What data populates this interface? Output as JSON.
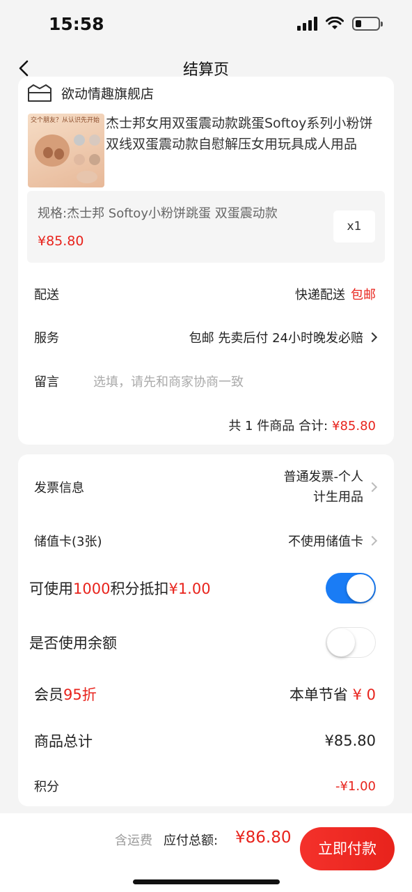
{
  "status_bar": {
    "time": "15:58",
    "battery_level": 0.28
  },
  "nav": {
    "title": "结算页",
    "back_icon": "chevron-left-icon"
  },
  "shop": {
    "name": "欲动情趣旗舰店",
    "icon": "store-icon"
  },
  "product": {
    "image_caption": "交个朋友？从认识先开始",
    "title": "杰士邦女用双蛋震动款跳蛋Softoy系列小粉饼双线双蛋震动款自慰解压女用玩具成人用品",
    "spec": "规格:杰士邦 Softoy小粉饼跳蛋 双蛋震动款",
    "price": "¥85.80",
    "quantity": "x1"
  },
  "delivery": {
    "label": "配送",
    "method": "快递配送",
    "tag": "包邮"
  },
  "service": {
    "label": "服务",
    "value": "包邮 先卖后付 24小时晚发必赔"
  },
  "message": {
    "label": "留言",
    "placeholder": "选填，请先和商家协商一致"
  },
  "order_total": {
    "count_text": "共 1 件商品 合计:",
    "amount": "¥85.80"
  },
  "invoice": {
    "label": "发票信息",
    "line1": "普通发票-个人",
    "line2": "计生用品"
  },
  "stored_card": {
    "label": "储值卡(3张)",
    "value": "不使用储值卡"
  },
  "points_deduct": {
    "prefix": "可使用",
    "points": "1000",
    "middle": "积分抵扣",
    "amount": "¥1.00",
    "enabled": true
  },
  "balance": {
    "label": "是否使用余额",
    "enabled": false
  },
  "member": {
    "label_prefix": "会员",
    "discount": "95折",
    "saving_label": "本单节省",
    "saving_amount": "¥ 0"
  },
  "goods_total": {
    "label": "商品总计",
    "amount": "¥85.80"
  },
  "points": {
    "label": "积分",
    "amount": "-¥1.00"
  },
  "bottom": {
    "shipping_note": "含运费",
    "payable_label": "应付总额:",
    "payable_amount": "¥86.80",
    "pay_button": "立即付款"
  },
  "colors": {
    "accent_red": "#e8231c",
    "toggle_blue": "#1a7cf5",
    "page_bg": "#f4f4f4"
  }
}
